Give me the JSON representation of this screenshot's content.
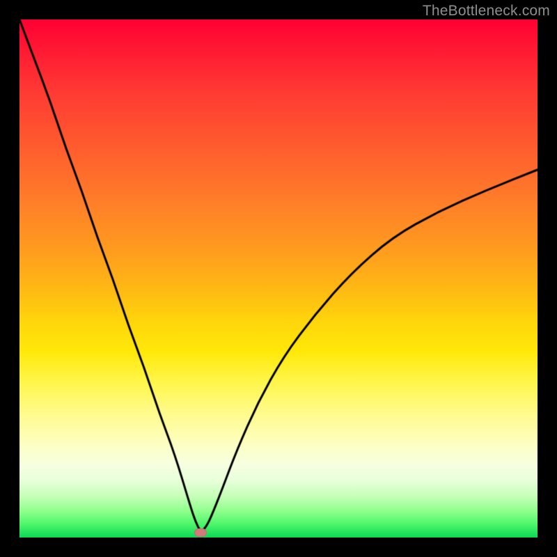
{
  "watermark": "TheBottleneck.com",
  "chart_data": {
    "type": "line",
    "title": "",
    "xlabel": "",
    "ylabel": "",
    "xlim": [
      0,
      100
    ],
    "ylim": [
      0,
      100
    ],
    "grid": false,
    "series": [
      {
        "name": "bottleneck-curve",
        "description": "V-shaped bottleneck curve; y≈100 at left edge, drops to ~0 near x≈35 (optimal), rises toward ~71 at x=100. Values estimated from pixel positions against a 0-100 axis.",
        "x": [
          0,
          3,
          6,
          9,
          12,
          15,
          18,
          21,
          24,
          27,
          30,
          33,
          34,
          35,
          36,
          37,
          39,
          42,
          46,
          51,
          57,
          64,
          72,
          81,
          90,
          100
        ],
        "values": [
          100,
          92,
          84,
          75,
          67,
          58,
          50,
          41,
          33,
          24,
          16,
          6,
          3,
          1,
          2,
          4,
          9,
          17,
          26,
          35,
          43,
          51,
          58,
          63,
          67,
          71
        ]
      }
    ],
    "annotations": [
      {
        "name": "optimal-point",
        "x": 35,
        "y": 1,
        "marker": "pill",
        "color": "#d17a7a"
      }
    ],
    "background_gradient": {
      "direction": "vertical",
      "stops": [
        {
          "pos": 0.0,
          "color": "#ff0033"
        },
        {
          "pos": 0.34,
          "color": "#ff7a2a"
        },
        {
          "pos": 0.64,
          "color": "#ffe808"
        },
        {
          "pos": 0.86,
          "color": "#f6ffe0"
        },
        {
          "pos": 1.0,
          "color": "#0ad854"
        }
      ]
    },
    "frame_color": "#000000"
  },
  "colors": {
    "curve": "#000000",
    "marker": "#d17a7a",
    "watermark": "#8e8e8e"
  }
}
